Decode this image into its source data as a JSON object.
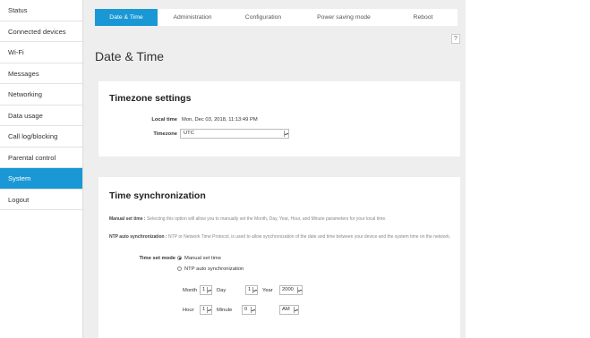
{
  "sidebar": {
    "items": [
      {
        "label": "Status"
      },
      {
        "label": "Connected devices"
      },
      {
        "label": "Wi-Fi"
      },
      {
        "label": "Messages"
      },
      {
        "label": "Networking"
      },
      {
        "label": "Data usage"
      },
      {
        "label": "Call log/blocking"
      },
      {
        "label": "Parental control"
      },
      {
        "label": "System",
        "active": true
      },
      {
        "label": "Logout"
      }
    ]
  },
  "tabs": [
    {
      "label": "Date & Time",
      "active": true
    },
    {
      "label": "Administration"
    },
    {
      "label": "Configuration"
    },
    {
      "label": "Power saving mode"
    },
    {
      "label": "Reboot"
    }
  ],
  "help_label": "?",
  "page_title": "Date & Time",
  "timezone_settings": {
    "title": "Timezone settings",
    "local_time_label": "Local time",
    "local_time_value": "Mon, Dec 03, 2018, 11:13:49 PM",
    "timezone_label": "Timezone",
    "timezone_value": "UTC"
  },
  "time_sync": {
    "title": "Time synchronization",
    "manual_heading": "Manual set time :",
    "manual_text": "Selecting this option will allow you to manually set the Month, Day, Year, Hour, and Minute parameters for your local time.",
    "ntp_heading": "NTP auto synchronization :",
    "ntp_text": "NTP or Network Time Protocol, is used to allow synchronization of the date and time between your device and the system time on the network.",
    "mode_label": "Time set mode",
    "option_manual": "Manual set time",
    "option_ntp": "NTP auto synchronization",
    "month_label": "Month",
    "month_value": "1",
    "day_label": "Day",
    "day_value": "1",
    "year_label": "Year",
    "year_value": "2000",
    "hour_label": "Hour",
    "hour_value": "1",
    "minute_label": "Minute",
    "minute_value": "0",
    "ampm_value": "AM"
  },
  "colors": {
    "accent": "#1a98d5",
    "background": "#eeeeee"
  }
}
